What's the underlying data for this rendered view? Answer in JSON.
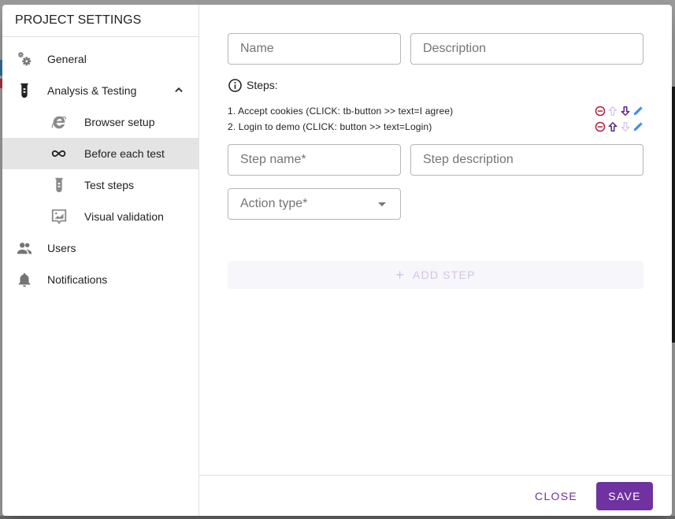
{
  "colors": {
    "accent": "#6f32a0",
    "remove": "#b0243a",
    "move_enabled": "#5b2a86",
    "move_disabled": "#d8c4ef",
    "edit": "#3e8ee6",
    "active_nav_bg": "#e4e4e4"
  },
  "sidebar": {
    "title": "PROJECT SETTINGS",
    "items": [
      {
        "label": "General",
        "icon": "gears-icon"
      },
      {
        "label": "Analysis & Testing",
        "icon": "test-tube-icon",
        "expanded": true,
        "children": [
          {
            "label": "Browser setup",
            "icon": "internet-explorer-icon"
          },
          {
            "label": "Before each test",
            "icon": "infinity-icon",
            "active": true
          },
          {
            "label": "Test steps",
            "icon": "test-tube-icon"
          },
          {
            "label": "Visual validation",
            "icon": "image-comment-icon"
          }
        ]
      },
      {
        "label": "Users",
        "icon": "people-icon"
      },
      {
        "label": "Notifications",
        "icon": "bell-icon"
      }
    ]
  },
  "form": {
    "name": {
      "placeholder": "Name",
      "value": ""
    },
    "description": {
      "placeholder": "Description",
      "value": ""
    },
    "steps_label": "Steps:",
    "steps": [
      {
        "text": "1. Accept cookies (CLICK: tb-button >> text=I agree)",
        "can_move_up": false,
        "can_move_down": true
      },
      {
        "text": "2. Login to demo (CLICK: button >> text=Login)",
        "can_move_up": true,
        "can_move_down": false
      }
    ],
    "step_name": {
      "placeholder": "Step name*",
      "value": ""
    },
    "step_description": {
      "placeholder": "Step description",
      "value": ""
    },
    "action_type": {
      "placeholder": "Action type*",
      "value": ""
    },
    "add_step_label": "ADD STEP",
    "add_step_disabled": true
  },
  "footer": {
    "close_label": "CLOSE",
    "save_label": "SAVE"
  }
}
